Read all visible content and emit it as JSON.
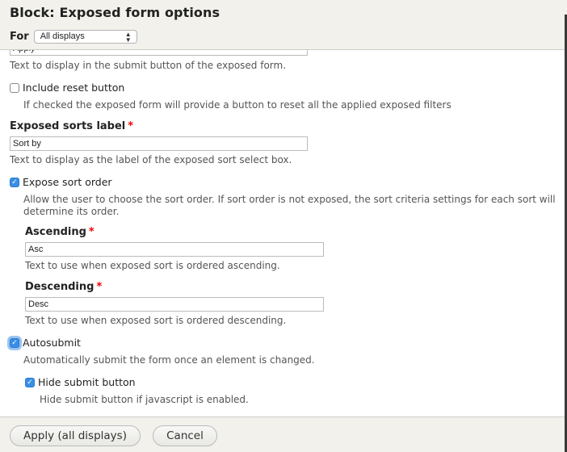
{
  "dialog": {
    "title": "Block: Exposed form options",
    "for_label": "For",
    "for_select": {
      "value": "All displays",
      "arrows": "▲▼"
    }
  },
  "fields": {
    "submit_button_text": {
      "value": "Apply",
      "description": "Text to display in the submit button of the exposed form."
    },
    "include_reset": {
      "label": "Include reset button",
      "checked": false,
      "description": "If checked the exposed form will provide a button to reset all the applied exposed filters"
    },
    "exposed_sorts_label": {
      "label": "Exposed sorts label",
      "required_mark": "*",
      "value": "Sort by",
      "description": "Text to display as the label of the exposed sort select box."
    },
    "expose_sort_order": {
      "label": "Expose sort order",
      "checked": true,
      "description_line1": "Allow the user to choose the sort order. If sort order is not exposed, the sort criteria settings for each sort will",
      "description_line2": "determine its order."
    },
    "ascending": {
      "label": "Ascending",
      "required_mark": "*",
      "value": "Asc",
      "description": "Text to use when exposed sort is ordered ascending."
    },
    "descending": {
      "label": "Descending",
      "required_mark": "*",
      "value": "Desc",
      "description": "Text to use when exposed sort is ordered descending."
    },
    "autosubmit": {
      "label": "Autosubmit",
      "checked": true,
      "description": "Automatically submit the form once an element is changed."
    },
    "hide_submit": {
      "label": "Hide submit button",
      "checked": true,
      "description": "Hide submit button if javascript is enabled."
    }
  },
  "check_glyph": "✓",
  "footer": {
    "apply_label": "Apply (all displays)",
    "cancel_label": "Cancel"
  }
}
